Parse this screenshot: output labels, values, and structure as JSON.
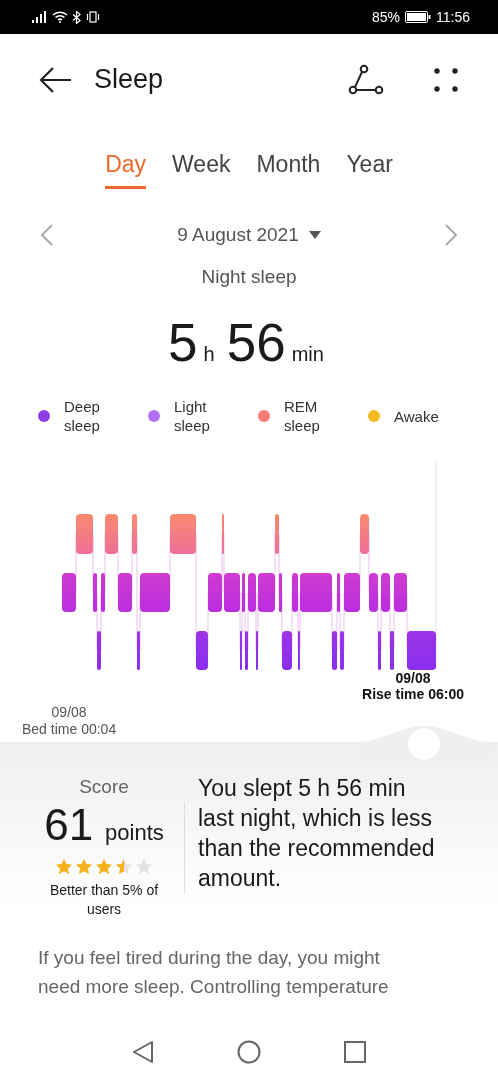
{
  "status_bar": {
    "battery": "85%",
    "time": "11:56"
  },
  "header": {
    "title": "Sleep"
  },
  "tabs": [
    {
      "label": "Day",
      "selected": true
    },
    {
      "label": "Week",
      "selected": false
    },
    {
      "label": "Month",
      "selected": false
    },
    {
      "label": "Year",
      "selected": false
    }
  ],
  "date": {
    "label": "9 August 2021"
  },
  "section_title": "Night sleep",
  "duration": {
    "hours": "5",
    "hours_unit": "h",
    "minutes": "56",
    "minutes_unit": "min"
  },
  "legend": [
    {
      "label": "Deep sleep",
      "color": "#8e3ee6"
    },
    {
      "label": "Light sleep",
      "color": "#b26ef6"
    },
    {
      "label": "REM sleep",
      "color": "#f47a76"
    },
    {
      "label": "Awake",
      "color": "#f6ba26"
    }
  ],
  "chart": {
    "rise_date": "09/08",
    "rise_time": "Rise time 06:00",
    "bed_date": "09/08",
    "bed_time": "Bed time 00:04"
  },
  "score": {
    "label": "Score",
    "value": "61",
    "unit": "points",
    "stars": 3.5,
    "comparison": "Better than 5% of users"
  },
  "summary": "You slept 5 h 56 min last night, which is less than the recommended amount.",
  "advice": "If you feel tired during the day, you might need more sleep. Controlling temperature"
}
